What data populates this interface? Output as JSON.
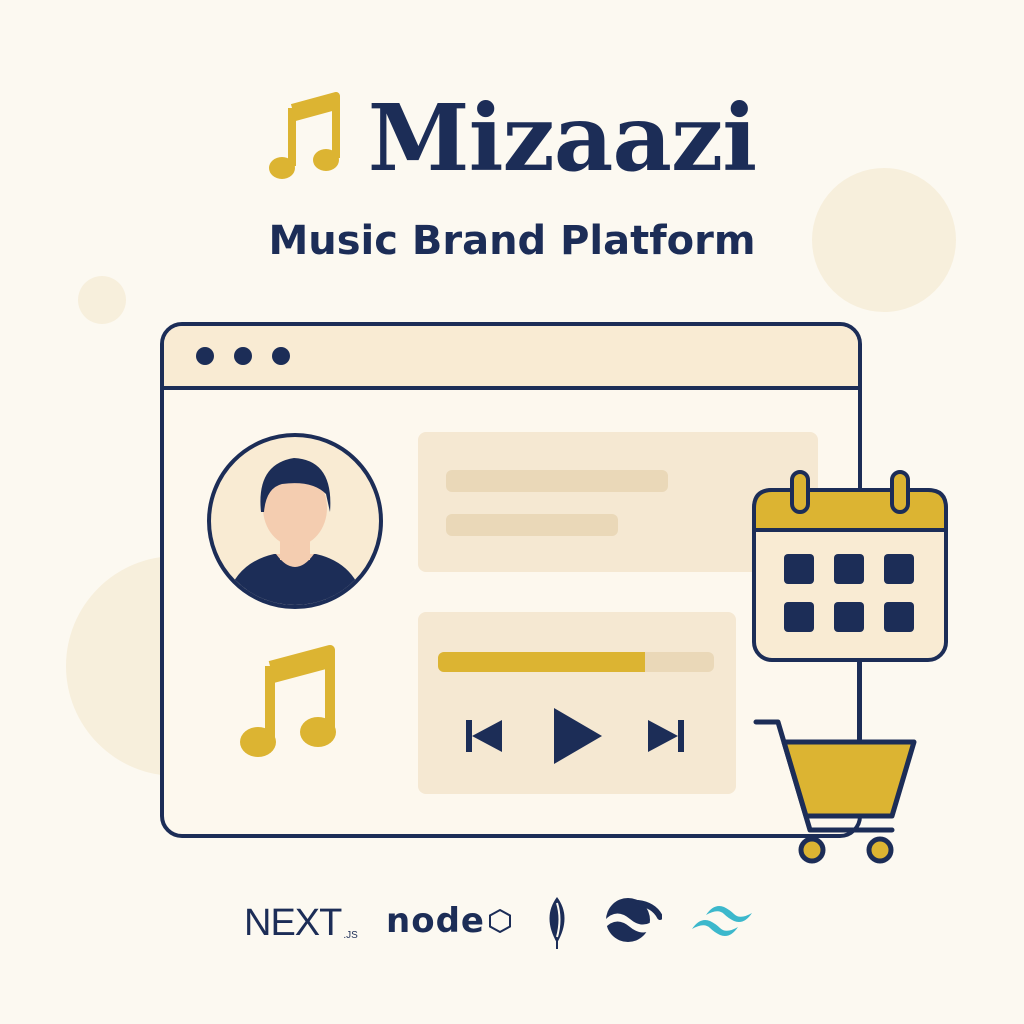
{
  "brand": {
    "title": "Mizaazi",
    "subtitle": "Music Brand Platform",
    "logo_icon": "music-note-icon"
  },
  "colors": {
    "navy": "#1c2d57",
    "gold": "#dcb432",
    "cream": "#fcf9f1",
    "panel": "#f5e8d2",
    "tailwind_teal": "#3cb8cc"
  },
  "player": {
    "progress": 0.75,
    "controls": [
      "previous-icon",
      "play-icon",
      "next-icon"
    ]
  },
  "tech_stack": {
    "next_label": "NEXT",
    "next_suffix": ".JS",
    "node_label": "node",
    "icons": [
      "nextjs-logo",
      "nodejs-logo",
      "mongodb-leaf-icon",
      "wave-logo-icon",
      "tailwind-logo-icon"
    ]
  }
}
